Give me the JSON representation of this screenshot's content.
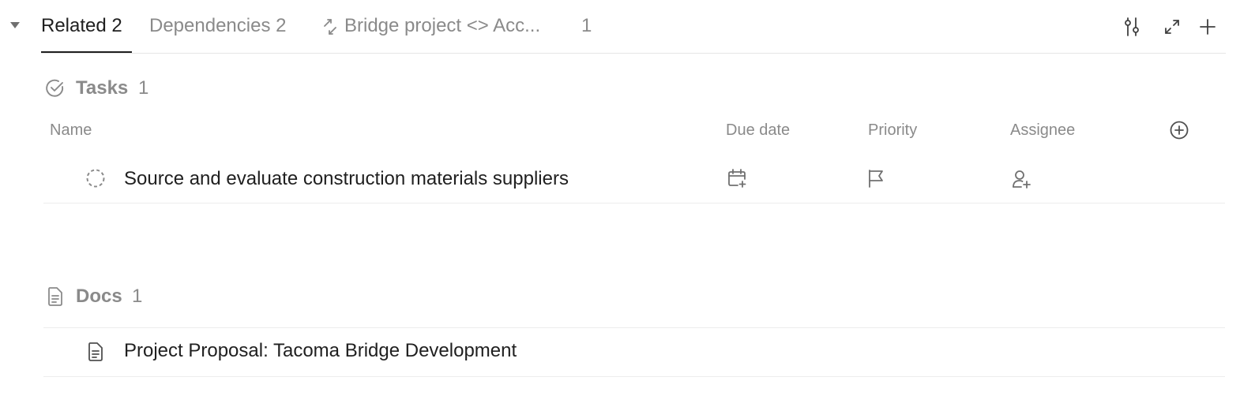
{
  "tabs": {
    "related": {
      "label": "Related",
      "count": "2"
    },
    "dependencies": {
      "label": "Dependencies",
      "count": "2"
    },
    "bridge": {
      "label": "Bridge project <> Acc...",
      "count": "1"
    }
  },
  "tasks": {
    "title": "Tasks",
    "count": "1",
    "columns": {
      "name": "Name",
      "due_date": "Due date",
      "priority": "Priority",
      "assignee": "Assignee"
    },
    "rows": [
      {
        "name": "Source and evaluate construction materials suppliers"
      }
    ]
  },
  "docs": {
    "title": "Docs",
    "count": "1",
    "rows": [
      {
        "name": "Project Proposal: Tacoma Bridge Development"
      }
    ]
  },
  "icons": {
    "collapse": "caret-down-icon",
    "bridge_tab": "sync-arrows-icon",
    "settings": "sliders-icon",
    "expand": "expand-icon",
    "add": "plus-icon",
    "tasks": "check-circle-icon",
    "add_column": "plus-circle-icon",
    "task_status": "dashed-circle-icon",
    "due_date": "calendar-plus-icon",
    "priority": "flag-icon",
    "assignee": "user-plus-icon",
    "docs": "document-icon"
  },
  "colors": {
    "text": "#202020",
    "muted": "#8a8a8a",
    "divider": "#ececec",
    "background": "#ffffff"
  }
}
